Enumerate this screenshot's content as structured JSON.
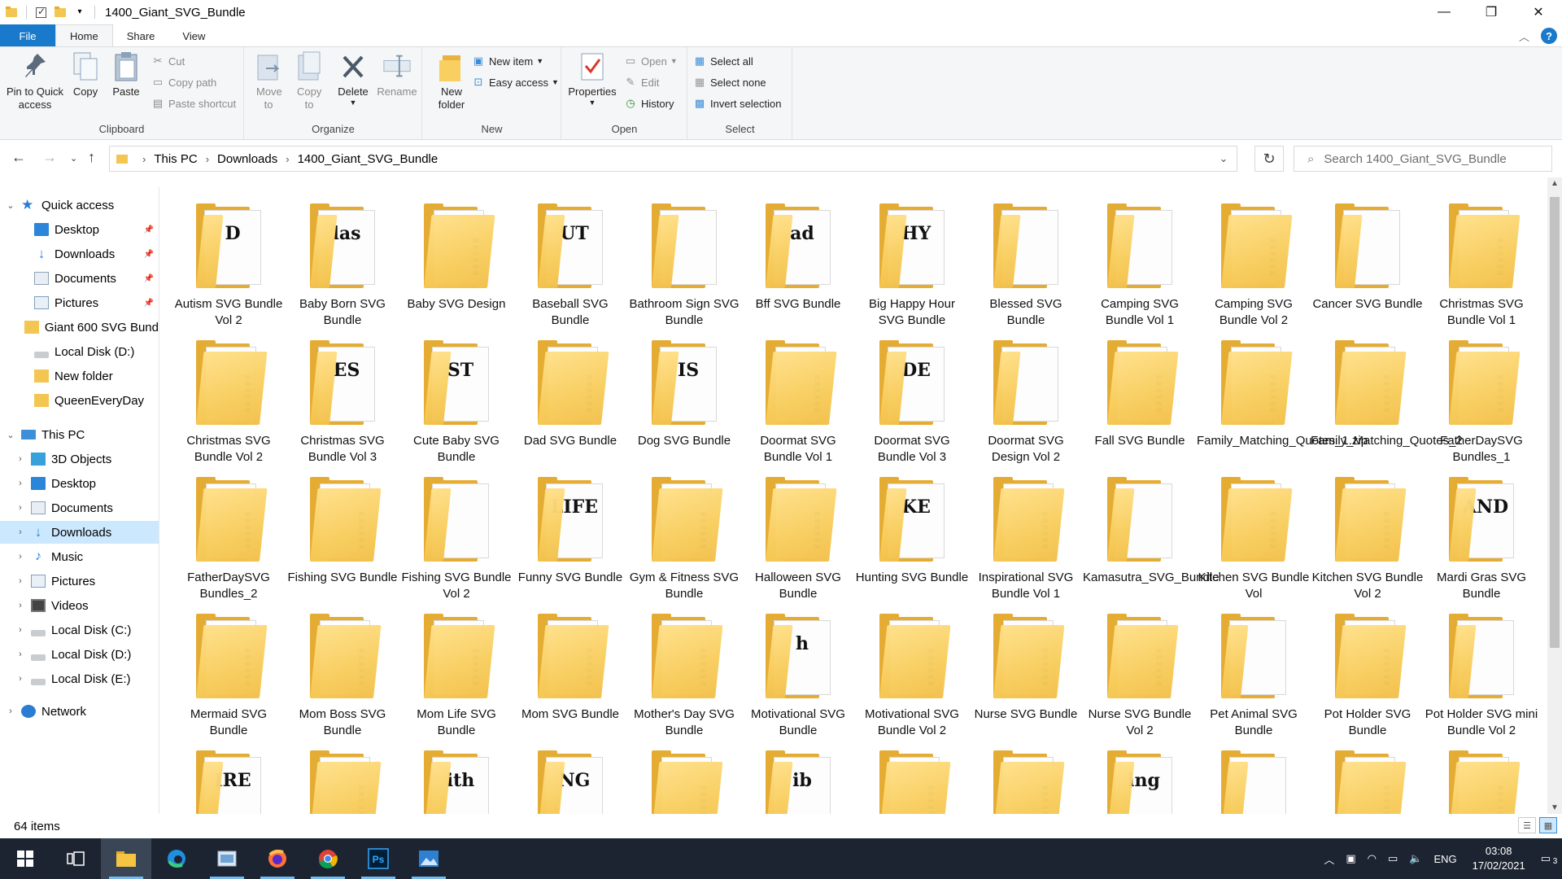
{
  "window": {
    "title": "1400_Giant_SVG_Bundle",
    "controls": [
      "—",
      "❐",
      "✕"
    ]
  },
  "ribbon_tabs": [
    "File",
    "Home",
    "Share",
    "View"
  ],
  "ribbon": {
    "clipboard": {
      "label": "Clipboard",
      "pin": "Pin to Quick access",
      "copy": "Copy",
      "paste": "Paste",
      "cut": "Cut",
      "copy_path": "Copy path",
      "paste_shortcut": "Paste shortcut"
    },
    "organize": {
      "label": "Organize",
      "move_to": "Move to",
      "copy_to": "Copy to",
      "delete": "Delete",
      "rename": "Rename"
    },
    "new": {
      "label": "New",
      "new_folder": "New folder",
      "new_item": "New item",
      "easy_access": "Easy access"
    },
    "open": {
      "label": "Open",
      "properties": "Properties",
      "open": "Open",
      "edit": "Edit",
      "history": "History"
    },
    "select": {
      "label": "Select",
      "select_all": "Select all",
      "select_none": "Select none",
      "invert": "Invert selection"
    }
  },
  "address": {
    "crumbs": [
      "This PC",
      "Downloads",
      "1400_Giant_SVG_Bundle"
    ],
    "search_placeholder": "Search 1400_Giant_SVG_Bundle"
  },
  "nav": {
    "quick_access": "Quick access",
    "quick_items": [
      {
        "label": "Desktop",
        "icon": "desktop-icon",
        "pinned": true
      },
      {
        "label": "Downloads",
        "icon": "downloads-icon",
        "pinned": true
      },
      {
        "label": "Documents",
        "icon": "documents-icon",
        "pinned": true
      },
      {
        "label": "Pictures",
        "icon": "pictures-icon",
        "pinned": true
      },
      {
        "label": "Giant 600 SVG Bund",
        "icon": "folder-icon",
        "pinned": false
      },
      {
        "label": "Local Disk (D:)",
        "icon": "disk-icon",
        "pinned": false
      },
      {
        "label": "New folder",
        "icon": "folder-icon",
        "pinned": false
      },
      {
        "label": "QueenEveryDay",
        "icon": "folder-icon",
        "pinned": false
      }
    ],
    "this_pc": "This PC",
    "pc_items": [
      {
        "label": "3D Objects",
        "icon": "3d-objects-icon"
      },
      {
        "label": "Desktop",
        "icon": "desktop-icon"
      },
      {
        "label": "Documents",
        "icon": "documents-icon"
      },
      {
        "label": "Downloads",
        "icon": "downloads-icon",
        "selected": true
      },
      {
        "label": "Music",
        "icon": "music-icon"
      },
      {
        "label": "Pictures",
        "icon": "pictures-icon"
      },
      {
        "label": "Videos",
        "icon": "videos-icon"
      },
      {
        "label": "Local Disk (C:)",
        "icon": "disk-icon"
      },
      {
        "label": "Local Disk (D:)",
        "icon": "disk-icon"
      },
      {
        "label": "Local Disk (E:)",
        "icon": "disk-icon"
      }
    ],
    "network": "Network"
  },
  "folders": [
    {
      "name": "Autism SVG Bundle Vol 2",
      "preview": "D",
      "open": true
    },
    {
      "name": "Baby Born SVG Bundle",
      "preview": "las",
      "open": true
    },
    {
      "name": "Baby SVG Design",
      "preview": "",
      "open": false
    },
    {
      "name": "Baseball SVG Bundle",
      "preview": "UT",
      "open": true
    },
    {
      "name": "Bathroom Sign SVG Bundle",
      "preview": "",
      "open": true
    },
    {
      "name": "Bff SVG Bundle",
      "preview": "ad",
      "open": true
    },
    {
      "name": "Big Happy Hour SVG Bundle",
      "preview": "HY",
      "open": true
    },
    {
      "name": "Blessed SVG Bundle",
      "preview": "",
      "open": true
    },
    {
      "name": "Camping SVG Bundle Vol 1",
      "preview": "",
      "open": true
    },
    {
      "name": "Camping SVG Bundle Vol 2",
      "preview": "",
      "open": false
    },
    {
      "name": "Cancer SVG Bundle",
      "preview": "",
      "open": true
    },
    {
      "name": "Christmas SVG Bundle Vol 1",
      "preview": "",
      "open": false
    },
    {
      "name": "Christmas SVG Bundle Vol 2",
      "preview": "",
      "open": false
    },
    {
      "name": "Christmas SVG Bundle Vol 3",
      "preview": "ES",
      "open": true
    },
    {
      "name": "Cute Baby SVG Bundle",
      "preview": "ST",
      "open": true
    },
    {
      "name": "Dad SVG Bundle",
      "preview": "",
      "open": false
    },
    {
      "name": "Dog SVG Bundle",
      "preview": "IS",
      "open": true
    },
    {
      "name": "Doormat SVG Bundle Vol 1",
      "preview": "",
      "open": false
    },
    {
      "name": "Doormat SVG Bundle Vol 3",
      "preview": "DE",
      "open": true
    },
    {
      "name": "Doormat SVG Design Vol 2",
      "preview": "",
      "open": true
    },
    {
      "name": "Fall SVG Bundle",
      "preview": "",
      "open": false
    },
    {
      "name": "Family_Matching_Quotes_1.zip",
      "preview": "",
      "open": false
    },
    {
      "name": "Family_Matching_Quotes_2",
      "preview": "",
      "open": false
    },
    {
      "name": "FatherDaySVG Bundles_1",
      "preview": "",
      "open": false
    },
    {
      "name": "FatherDaySVG Bundles_2",
      "preview": "",
      "open": false
    },
    {
      "name": "Fishing SVG Bundle",
      "preview": "",
      "open": false
    },
    {
      "name": "Fishing SVG Bundle Vol 2",
      "preview": "",
      "open": true
    },
    {
      "name": "Funny SVG Bundle",
      "preview": "LIFE",
      "open": true
    },
    {
      "name": "Gym & Fitness SVG Bundle",
      "preview": "",
      "open": false
    },
    {
      "name": "Halloween SVG Bundle",
      "preview": "",
      "open": false
    },
    {
      "name": "Hunting SVG Bundle",
      "preview": "KE",
      "open": true
    },
    {
      "name": "Inspirational SVG Bundle Vol 1",
      "preview": "",
      "open": false
    },
    {
      "name": "Kamasutra_SVG_Bundle",
      "preview": "",
      "open": true
    },
    {
      "name": "Kitchen SVG Bundle Vol",
      "preview": "",
      "open": false
    },
    {
      "name": "Kitchen SVG Bundle Vol 2",
      "preview": "",
      "open": false
    },
    {
      "name": "Mardi Gras SVG Bundle",
      "preview": "AND",
      "open": true
    },
    {
      "name": "Mermaid SVG Bundle",
      "preview": "",
      "open": false
    },
    {
      "name": "Mom Boss SVG Bundle",
      "preview": "",
      "open": false
    },
    {
      "name": "Mom Life SVG Bundle",
      "preview": "",
      "open": false
    },
    {
      "name": "Mom SVG Bundle",
      "preview": "",
      "open": false
    },
    {
      "name": "Mother's Day SVG Bundle",
      "preview": "",
      "open": false
    },
    {
      "name": "Motivational SVG Bundle",
      "preview": "h",
      "open": true
    },
    {
      "name": "Motivational SVG Bundle Vol 2",
      "preview": "",
      "open": false
    },
    {
      "name": "Nurse SVG Bundle",
      "preview": "",
      "open": false
    },
    {
      "name": "Nurse SVG Bundle Vol 2",
      "preview": "",
      "open": false
    },
    {
      "name": "Pet Animal SVG Bundle",
      "preview": "",
      "open": true
    },
    {
      "name": "Pot Holder SVG Bundle",
      "preview": "",
      "open": false
    },
    {
      "name": "Pot Holder SVG mini Bundle Vol 2",
      "preview": "",
      "open": true
    },
    {
      "name": "",
      "preview": "IRE",
      "open": true
    },
    {
      "name": "",
      "preview": "",
      "open": false
    },
    {
      "name": "",
      "preview": "ith",
      "open": true
    },
    {
      "name": "",
      "preview": "NG",
      "open": true
    },
    {
      "name": "",
      "preview": "",
      "open": false
    },
    {
      "name": "",
      "preview": "ib",
      "open": true
    },
    {
      "name": "",
      "preview": "",
      "open": false
    },
    {
      "name": "",
      "preview": "",
      "open": false
    },
    {
      "name": "",
      "preview": "ing",
      "open": true
    },
    {
      "name": "",
      "preview": "",
      "open": true
    },
    {
      "name": "",
      "preview": "",
      "open": false
    },
    {
      "name": "",
      "preview": "",
      "open": false
    }
  ],
  "status": {
    "item_count": "64 items"
  },
  "taskbar": {
    "lang": "ENG",
    "time": "03:08",
    "date": "17/02/2021",
    "notifications": "3"
  }
}
